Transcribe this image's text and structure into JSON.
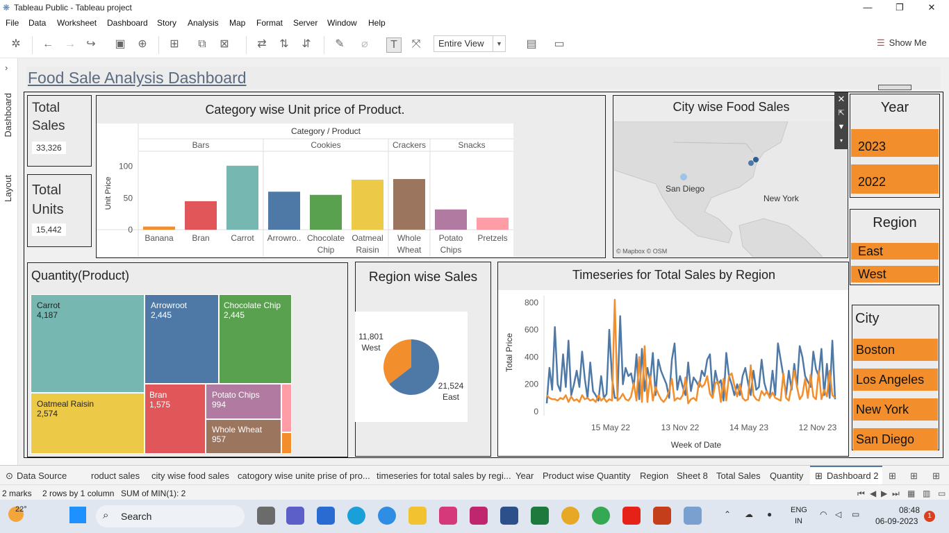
{
  "window": {
    "title": "Tableau Public - Tableau project",
    "minimize": "—",
    "restore": "❐",
    "close": "✕"
  },
  "menu": [
    "File",
    "Data",
    "Worksheet",
    "Dashboard",
    "Story",
    "Analysis",
    "Map",
    "Format",
    "Server",
    "Window",
    "Help"
  ],
  "toolbar": {
    "view_select": "Entire View",
    "show_me": "Show Me"
  },
  "side_tabs": [
    "Dashboard",
    "Layout"
  ],
  "dashboard": {
    "title": "Food Sale Analysis Dashboard",
    "total_sales": {
      "label_line1": "Total",
      "label_line2": "Sales",
      "value": "33,326"
    },
    "total_units": {
      "label_line1": "Total",
      "label_line2": "Units",
      "value": "15,442"
    }
  },
  "chart_data": [
    {
      "type": "bar",
      "title": "Category wise Unit price of Product.",
      "header": "Category / Product",
      "ylabel": "Unit Price",
      "yticks": [
        "100",
        "50",
        "0"
      ],
      "ylim": [
        0,
        115
      ],
      "groups": [
        {
          "name": "Bars",
          "products": [
            "Banana",
            "Bran",
            "Carrot"
          ]
        },
        {
          "name": "Cookies",
          "products": [
            "Arrowro..",
            "Chocolate Chip",
            "Oatmeal Raisin"
          ]
        },
        {
          "name": "Crackers",
          "products": [
            "Whole Wheat"
          ]
        },
        {
          "name": "Snacks",
          "products": [
            "Potato Chips",
            "Pretzels"
          ]
        }
      ],
      "categories": [
        "Banana",
        "Bran",
        "Carrot",
        "Arrowro..",
        "Chocolate Chip",
        "Oatmeal Raisin",
        "Whole Wheat",
        "Potato Chips",
        "Pretzels"
      ],
      "values": [
        5,
        45,
        101,
        60,
        55,
        79,
        80,
        32,
        19
      ],
      "colors": [
        "#f28e2b",
        "#e15759",
        "#76b7b2",
        "#4e79a7",
        "#59a14f",
        "#edc948",
        "#9c755f",
        "#b07aa1",
        "#ff9da7"
      ]
    },
    {
      "type": "treemap",
      "title": "Quantity(Product)",
      "items": [
        {
          "name": "Carrot",
          "value": "4,187",
          "color": "#76b7b2"
        },
        {
          "name": "Arrowroot",
          "value": "2,445",
          "color": "#4e79a7"
        },
        {
          "name": "Chocolate Chip",
          "value": "2,445",
          "color": "#59a14f"
        },
        {
          "name": "Oatmeal Raisin",
          "value": "2,574",
          "color": "#edc948"
        },
        {
          "name": "Bran",
          "value": "1,575",
          "color": "#e15759"
        },
        {
          "name": "Potato Chips",
          "value": "994",
          "color": "#b07aa1"
        },
        {
          "name": "Whole Wheat",
          "value": "957",
          "color": "#9c755f"
        },
        {
          "name": "Pretzels",
          "value": "",
          "color": "#ff9da7"
        },
        {
          "name": "Banana",
          "value": "",
          "color": "#f28e2b"
        }
      ]
    },
    {
      "type": "pie",
      "title": "Region wise Sales",
      "slices": [
        {
          "label": "East",
          "value": 21524,
          "display": "21,524",
          "color": "#4e79a7"
        },
        {
          "label": "West",
          "value": 11801,
          "display": "11,801",
          "color": "#f28e2b"
        }
      ]
    },
    {
      "type": "line",
      "title": "Timeseries for Total Sales by Region",
      "xlabel": "Week of Date",
      "ylabel": "Total Price",
      "xticks": [
        "15 May 22",
        "13 Nov 22",
        "14 May 23",
        "12 Nov 23"
      ],
      "yticks": [
        "800",
        "600",
        "400",
        "200",
        "0"
      ],
      "ylim": [
        0,
        850
      ],
      "series": [
        {
          "color": "#4e79a7",
          "values": [
            60,
            320,
            160,
            620,
            200,
            150,
            420,
            180,
            520,
            120,
            200,
            300,
            180,
            440,
            240,
            100,
            360,
            150,
            120,
            80,
            260,
            100,
            130,
            600,
            240,
            100,
            100,
            700,
            200,
            320,
            260,
            280,
            180,
            420,
            90,
            460,
            150,
            320,
            220,
            430,
            120,
            380,
            300,
            250,
            200,
            100,
            380,
            500,
            160,
            260,
            180,
            120,
            360,
            150,
            250,
            220,
            180,
            300,
            260,
            380,
            420,
            120,
            300,
            200,
            230,
            80,
            430,
            260,
            200,
            120,
            200,
            120,
            260,
            320,
            210,
            120,
            300,
            160,
            180,
            380,
            210,
            140,
            110,
            300,
            120,
            500,
            380,
            260,
            120,
            300,
            160,
            350,
            180,
            480,
            400,
            260,
            220,
            180,
            440,
            310,
            260,
            460,
            120,
            350,
            100,
            520,
            90
          ]
        },
        {
          "color": "#f28e2b",
          "values": [
            120,
            100,
            90,
            90,
            80,
            100,
            90,
            120,
            70,
            110,
            80,
            90,
            70,
            120,
            90,
            100,
            80,
            90,
            70,
            120,
            80,
            100,
            70,
            90,
            80,
            820,
            80,
            100,
            130,
            90,
            80,
            110,
            210,
            80,
            400,
            70,
            480,
            70,
            260,
            80,
            180,
            130,
            90,
            70,
            100,
            150,
            240,
            80,
            100,
            90,
            120,
            250,
            60,
            90,
            100,
            80,
            220,
            180,
            200,
            260,
            130,
            100,
            210,
            220,
            70,
            240,
            80,
            260,
            280,
            190,
            110,
            200,
            100,
            80,
            90,
            340,
            120,
            90,
            80,
            150,
            120,
            150,
            100,
            140,
            100,
            90,
            80,
            280,
            100,
            80,
            190,
            300,
            180,
            90,
            120,
            240,
            100,
            270,
            110,
            90,
            300,
            90,
            160,
            110,
            300,
            120,
            100
          ]
        }
      ]
    },
    {
      "type": "map",
      "title": "City wise Food Sales",
      "cities": [
        {
          "name": "San Diego"
        },
        {
          "name": "New York"
        }
      ],
      "attribution": "© Mapbox © OSM"
    }
  ],
  "filters": {
    "year": {
      "title": "Year",
      "items": [
        "2023",
        "2022"
      ]
    },
    "region": {
      "title": "Region",
      "items": [
        "East",
        "West"
      ]
    },
    "city": {
      "title": "City",
      "items": [
        "Boston",
        "Los Angeles",
        "New York",
        "San Diego"
      ]
    }
  },
  "tabs": [
    "Data Source",
    "roduct sales",
    "city wise food sales",
    "catogory wise unite prise of pro...",
    "timeseries for total sales by regi...",
    "Year",
    "Product wise Quantity",
    "Region",
    "Sheet 8",
    "Total Sales",
    "Quantity",
    "Dashboard 2"
  ],
  "status": {
    "marks": "2 marks",
    "rows": "2 rows by 1 column",
    "sum": "SUM of MIN(1): 2"
  },
  "taskbar": {
    "weather": "22°",
    "search": "Search",
    "lang1": "ENG",
    "lang2": "IN",
    "time": "08:48",
    "date": "06-09-2023",
    "notif": "1"
  }
}
